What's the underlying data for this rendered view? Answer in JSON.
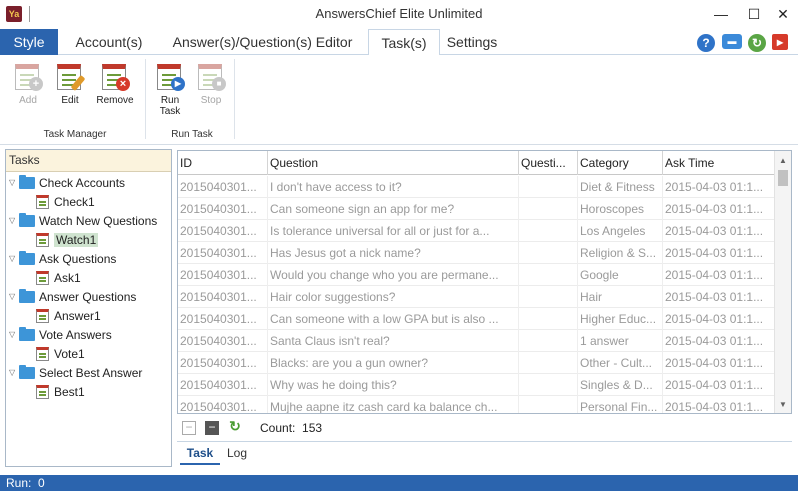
{
  "window": {
    "title": "AnswersChief Elite Unlimited",
    "app_icon_text": "Ya",
    "minimize": "—",
    "maximize": "☐",
    "close": "✕"
  },
  "tabs": [
    {
      "label": "Style",
      "active": false
    },
    {
      "label": "Account(s)",
      "active": false
    },
    {
      "label": "Answer(s)/Question(s) Editor",
      "active": false
    },
    {
      "label": "Task(s)",
      "active": true
    },
    {
      "label": "Settings",
      "active": false
    }
  ],
  "top_icons": [
    "help-icon",
    "chat-icon",
    "refresh-icon",
    "exit-icon"
  ],
  "ribbon": {
    "groups": [
      {
        "label": "Task Manager",
        "buttons": [
          {
            "label": "Add",
            "enabled": false,
            "icon": "calendar-add-icon"
          },
          {
            "label": "Edit",
            "enabled": true,
            "icon": "calendar-edit-icon"
          },
          {
            "label": "Remove",
            "enabled": true,
            "icon": "calendar-remove-icon"
          }
        ]
      },
      {
        "label": "Run Task",
        "buttons": [
          {
            "label": "Run\nTask",
            "enabled": true,
            "icon": "calendar-run-icon"
          },
          {
            "label": "Stop",
            "enabled": false,
            "icon": "calendar-stop-icon"
          }
        ]
      }
    ]
  },
  "tree": {
    "header": "Tasks",
    "nodes": [
      {
        "label": "Check Accounts",
        "children": [
          "Check1"
        ]
      },
      {
        "label": "Watch New Questions",
        "children": [
          "Watch1"
        ]
      },
      {
        "label": "Ask Questions",
        "children": [
          "Ask1"
        ]
      },
      {
        "label": "Answer Questions",
        "children": [
          "Answer1"
        ]
      },
      {
        "label": "Vote Answers",
        "children": [
          "Vote1"
        ]
      },
      {
        "label": "Select Best Answer",
        "children": [
          "Best1"
        ]
      }
    ],
    "selected": "Watch1"
  },
  "grid": {
    "columns": [
      "ID",
      "Question",
      "Questi...",
      "Category",
      "Ask Time"
    ],
    "rows": [
      [
        "2015040301...",
        "I don't have access to it?",
        "",
        "Diet & Fitness",
        "2015-04-03 01:1..."
      ],
      [
        "2015040301...",
        "Can someone sign an app for me?",
        "",
        "Horoscopes",
        "2015-04-03 01:1..."
      ],
      [
        "2015040301...",
        "Is tolerance universal for all or just for a...",
        "",
        "Los Angeles",
        "2015-04-03 01:1..."
      ],
      [
        "2015040301...",
        "Has Jesus got a nick name?",
        "",
        "Religion & S...",
        "2015-04-03 01:1..."
      ],
      [
        "2015040301...",
        "Would you change who you are permane...",
        "",
        "Google",
        "2015-04-03 01:1..."
      ],
      [
        "2015040301...",
        "Hair color suggestions?",
        "",
        "Hair",
        "2015-04-03 01:1..."
      ],
      [
        "2015040301...",
        "Can someone with a low GPA but is also ...",
        "",
        "Higher Educ...",
        "2015-04-03 01:1..."
      ],
      [
        "2015040301...",
        "Santa Claus isn't real?",
        "",
        "1 answer",
        "2015-04-03 01:1..."
      ],
      [
        "2015040301...",
        "Blacks: are you a gun owner?",
        "",
        "Other - Cult...",
        "2015-04-03 01:1..."
      ],
      [
        "2015040301...",
        "Why was he doing this?",
        "",
        "Singles & D...",
        "2015-04-03 01:1..."
      ],
      [
        "2015040301...",
        "Mujhe aapne itz cash card ka balance ch...",
        "",
        "Personal Fin...",
        "2015-04-03 01:1..."
      ]
    ]
  },
  "footer": {
    "count_label": "Count:",
    "count_value": "153",
    "bottom_tabs": [
      "Task",
      "Log"
    ]
  },
  "status": {
    "text": "Run:  0"
  },
  "colors": {
    "accent": "#2b64ae",
    "tree_header": "#fbf3dd",
    "selected_node": "#cfe3cf"
  }
}
